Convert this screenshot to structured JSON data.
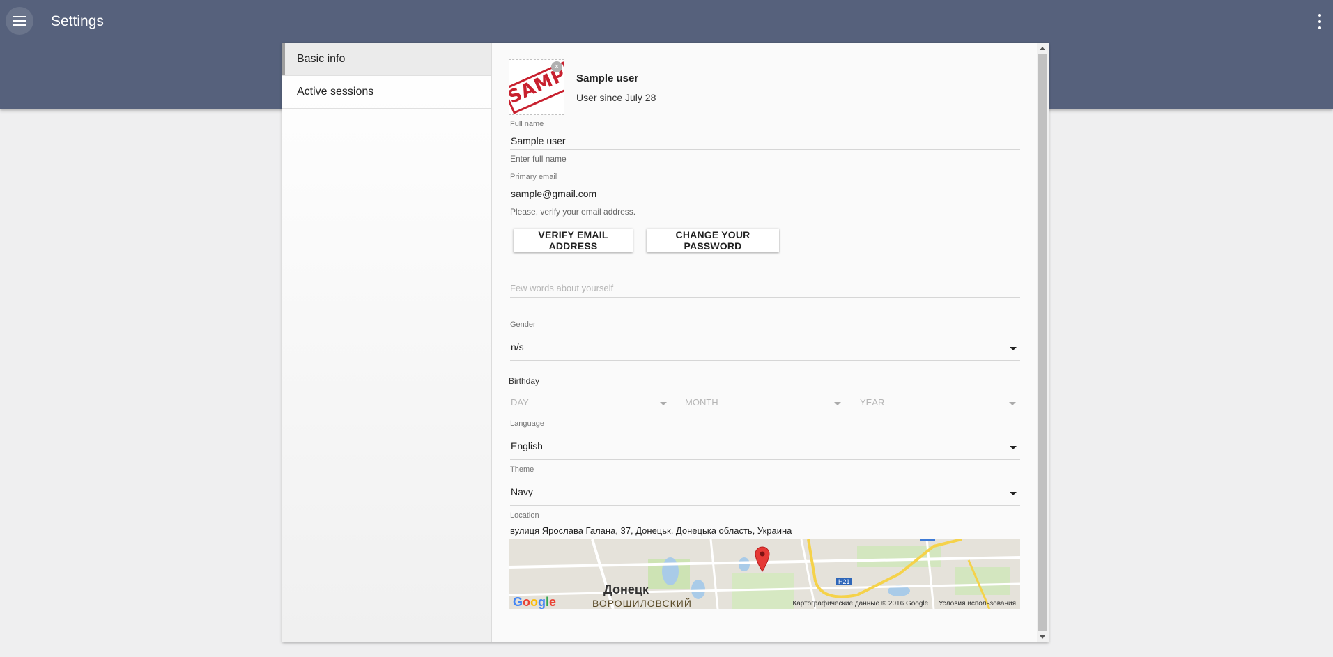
{
  "appbar": {
    "title": "Settings",
    "menu_icon": "hamburger-menu-icon",
    "more_icon": "more-vert-icon"
  },
  "sidebar": {
    "items": [
      {
        "label": "Basic info",
        "active": true
      },
      {
        "label": "Active sessions",
        "active": false
      }
    ]
  },
  "profile": {
    "name": "Sample user",
    "since": "User since July 28",
    "avatar_stamp": "SAMPLE"
  },
  "full_name": {
    "label": "Full name",
    "value": "Sample user",
    "hint": "Enter full name"
  },
  "email": {
    "label": "Primary email",
    "value": "sample@gmail.com",
    "hint": "Please, verify your email address."
  },
  "buttons": {
    "verify": "VERIFY EMAIL ADDRESS",
    "change_password": "CHANGE YOUR PASSWORD"
  },
  "about": {
    "placeholder": "Few words about yourself"
  },
  "gender": {
    "label": "Gender",
    "value": "n/s"
  },
  "birthday": {
    "label": "Birthday",
    "day": "DAY",
    "month": "MONTH",
    "year": "YEAR"
  },
  "language": {
    "label": "Language",
    "value": "English"
  },
  "theme": {
    "label": "Theme",
    "value": "Navy"
  },
  "location": {
    "label": "Location",
    "value": "вулиця Ярослава Галана, 37, Донецьк, Донецька область, Украина",
    "map": {
      "city": "Донецк",
      "district": "ВОРОШИЛОВСКИЙ",
      "credit": "Картографические данные © 2016 Google",
      "terms": "Условия использования",
      "route_label": "H21",
      "marker_color": "#e53935"
    }
  },
  "colors": {
    "appbar": "#56617c",
    "accent": "#c8202e"
  }
}
